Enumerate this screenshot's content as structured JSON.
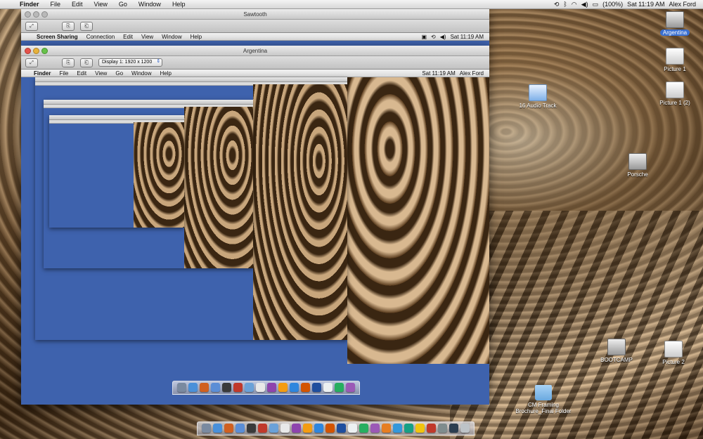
{
  "menubar": {
    "app": "Finder",
    "items": [
      "File",
      "Edit",
      "View",
      "Go",
      "Window",
      "Help"
    ],
    "battery": "(100%)",
    "clock": "Sat 11:19 AM",
    "user": "Alex Ford"
  },
  "desktop_icons": [
    {
      "label": "Argentina",
      "kind": "hdd",
      "selected": true
    },
    {
      "label": "Picture 1",
      "kind": "pic"
    },
    {
      "label": "Picture 1 (2)",
      "kind": "pic"
    },
    {
      "label": "16 Audio Track",
      "kind": "audio"
    },
    {
      "label": "Porsche",
      "kind": "hdd"
    },
    {
      "label": "BOOTCAMP",
      "kind": "hdd"
    },
    {
      "label": "Picture 2",
      "kind": "pic"
    },
    {
      "label": "CM Framing Brochure_Final Folder",
      "kind": "folder"
    }
  ],
  "window_sawtooth": {
    "title": "Sawtooth",
    "inner_menu": {
      "app": "Screen Sharing",
      "items": [
        "Connection",
        "Edit",
        "View",
        "Window",
        "Help"
      ],
      "clock": "Sat 11:19 AM"
    }
  },
  "window_argentina": {
    "title": "Argentina",
    "display_select": "Display 1: 1920 x 1200",
    "inner_menu": {
      "app": "Finder",
      "items": [
        "File",
        "Edit",
        "View",
        "Go",
        "Window",
        "Help"
      ],
      "clock": "Sat 11:19 AM",
      "user": "Alex Ford"
    }
  },
  "dock_colors": [
    "#7a8aa0",
    "#4a90d9",
    "#d06020",
    "#5b8ed6",
    "#3a3a3a",
    "#c0392b",
    "#6aa1d8",
    "#e8e8e8",
    "#8e44ad",
    "#f39c12",
    "#2e86de",
    "#d35400",
    "#1f4e9e",
    "#ecf0f1",
    "#27ae60",
    "#9b59b6",
    "#e67e22",
    "#3498db",
    "#16a085",
    "#f1c40f",
    "#c0392b",
    "#7f8c8d",
    "#2c3e50",
    "#bdc3c7"
  ]
}
